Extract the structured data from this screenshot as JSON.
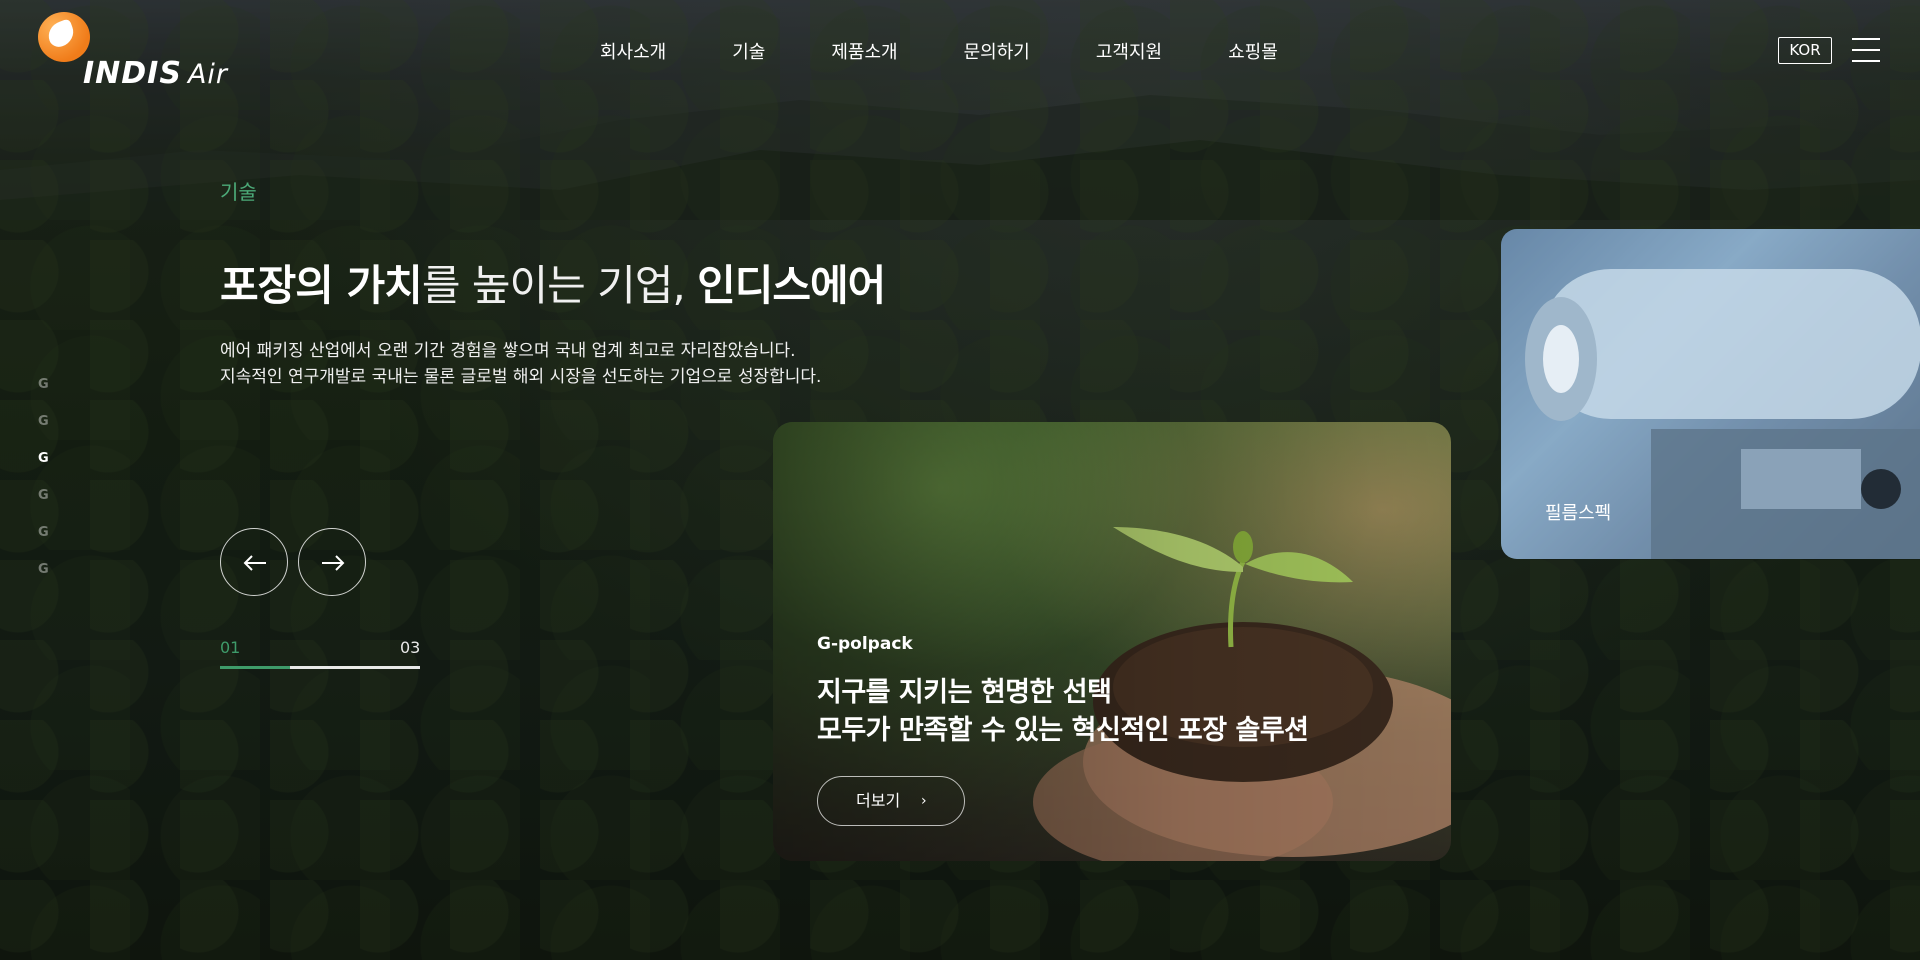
{
  "brand": {
    "name": "INDIS",
    "suffix": "Air"
  },
  "nav": {
    "items": [
      {
        "label": "회사소개"
      },
      {
        "label": "기술"
      },
      {
        "label": "제품소개"
      },
      {
        "label": "문의하기"
      },
      {
        "label": "고객지원"
      },
      {
        "label": "쇼핑몰"
      }
    ],
    "language": "KOR"
  },
  "side_nav": {
    "glyph": "G",
    "count": 6,
    "active_index": 2
  },
  "hero": {
    "section_label": "기술",
    "title": {
      "part1": "포장의 가치",
      "part2": "를 높이는 기업, ",
      "part3": "인디스에어"
    },
    "description": [
      "에어 패키징 산업에서 오랜 기간 경험을 쌓으며 국내 업계 최고로 자리잡았습니다.",
      "지속적인 연구개발로 국내는 물론 글로벌 해외 시장을 선도하는 기업으로 성장합니다."
    ]
  },
  "slider": {
    "current": "01",
    "total": "03",
    "progress": 0.35,
    "accent": "#3e9b6a"
  },
  "cards": {
    "active": {
      "tag": "G-polpack",
      "title_line1": "지구를 지키는 현명한 선택",
      "title_line2": "모두가 만족할 수 있는 혁신적인 포장 솔루션",
      "button": "더보기"
    },
    "next": {
      "label": "필름스펙"
    }
  },
  "colors": {
    "brand_orange": "#f07c1a",
    "section_green": "#4caa78"
  }
}
